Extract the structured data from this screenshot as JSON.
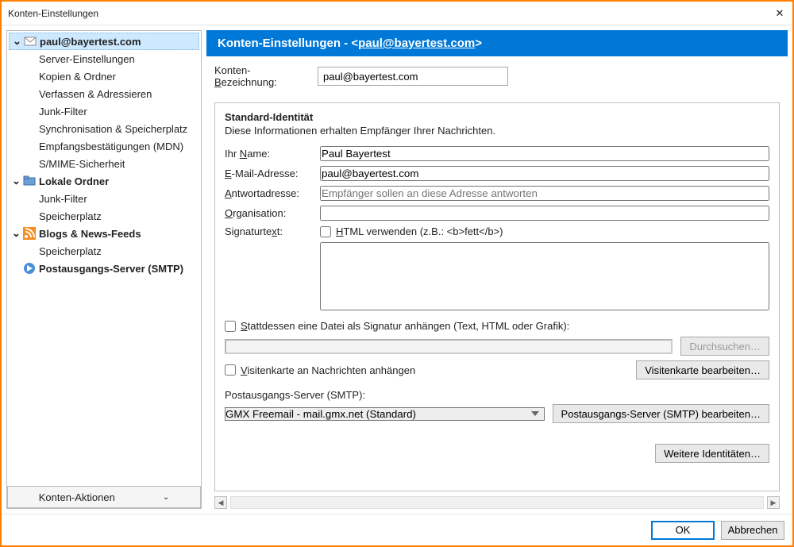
{
  "window": {
    "title": "Konten-Einstellungen"
  },
  "sidebar": {
    "items": [
      {
        "label": "paul@bayertest.com",
        "bold": true,
        "level": 0,
        "expandable": true,
        "icon": "mail"
      },
      {
        "label": "Server-Einstellungen",
        "level": 1
      },
      {
        "label": "Kopien & Ordner",
        "level": 1
      },
      {
        "label": "Verfassen & Adressieren",
        "level": 1
      },
      {
        "label": "Junk-Filter",
        "level": 1
      },
      {
        "label": "Synchronisation & Speicherplatz",
        "level": 1
      },
      {
        "label": "Empfangsbestätigungen (MDN)",
        "level": 1
      },
      {
        "label": "S/MIME-Sicherheit",
        "level": 1
      },
      {
        "label": "Lokale Ordner",
        "bold": true,
        "level": 0,
        "expandable": true,
        "icon": "folder"
      },
      {
        "label": "Junk-Filter",
        "level": 1
      },
      {
        "label": "Speicherplatz",
        "level": 1
      },
      {
        "label": "Blogs & News-Feeds",
        "bold": true,
        "level": 0,
        "expandable": true,
        "icon": "rss"
      },
      {
        "label": "Speicherplatz",
        "level": 1
      },
      {
        "label": "Postausgangs-Server (SMTP)",
        "bold": true,
        "level": 0,
        "icon": "smtp"
      }
    ],
    "selectedIndex": 0,
    "actionsLabel": "Konten-Aktionen"
  },
  "header": {
    "prefix": "Konten-Einstellungen - <",
    "email": "paul@bayertest.com",
    "suffix": ">"
  },
  "account": {
    "nameLabelPre": "Konten-",
    "nameUnder": "B",
    "nameLabelPost": "ezeichnung:",
    "nameValue": "paul@bayertest.com"
  },
  "identity": {
    "title": "Standard-Identität",
    "sub": "Diese Informationen erhalten Empfänger Ihrer Nachrichten.",
    "yourNamePre": "Ihr ",
    "yourNameUnder": "N",
    "yourNamePost": "ame:",
    "yourNameValue": "Paul Bayertest",
    "emailUnder": "E",
    "emailPost": "-Mail-Adresse:",
    "emailValue": "paul@bayertest.com",
    "replyUnder": "A",
    "replyPost": "ntwortadresse:",
    "replyPlaceholder": "Empfänger sollen an diese Adresse antworten",
    "orgUnder": "O",
    "orgPost": "rganisation:",
    "orgValue": "",
    "sigLabelPre": "Signaturte",
    "sigUnder": "x",
    "sigLabelPost": "t:",
    "htmlUnder": "H",
    "htmlLabel": "TML verwenden (z.B.: <b>fett</b>)",
    "sigText": "",
    "attachFilePre": "",
    "attachFileUnder": "S",
    "attachFileLabel": "tattdessen eine Datei als Signatur anhängen (Text, HTML oder Grafik):",
    "browseLabel": "Durchsuchen…",
    "vcardUnder": "V",
    "vcardLabel": "isitenkarte an Nachrichten anhängen",
    "editVcardLabel": "Visitenkarte bearbeiten…",
    "smtpLabel": "Postausgangs-Server (SMTP):",
    "smtpValue": "GMX Freemail - mail.gmx.net (Standard)",
    "editSmtpLabel": "Postausgangs-Server (SMTP) bearbeiten…",
    "moreIdentitiesLabel": "Weitere Identitäten…"
  },
  "footer": {
    "ok": "OK",
    "cancel": "Abbrechen"
  }
}
